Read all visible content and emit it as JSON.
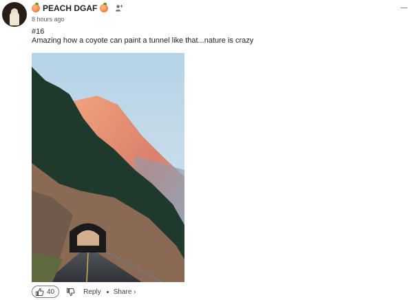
{
  "comment": {
    "author": "PEACH DGAF",
    "author_emoji_left": "peach-emoji",
    "author_emoji_right": "peach-emoji",
    "timestamp": "8 hours ago",
    "post_number": "#16",
    "text": "Amazing how a coyote can paint a tunnel like that...nature is crazy"
  },
  "actions": {
    "like_count": "40",
    "reply_label": "Reply",
    "share_label": "Share ›"
  },
  "icons": {
    "follow": "person-add-icon",
    "like": "thumbs-up-icon",
    "dislike": "thumbs-down-icon",
    "menu": "collapse-icon"
  }
}
